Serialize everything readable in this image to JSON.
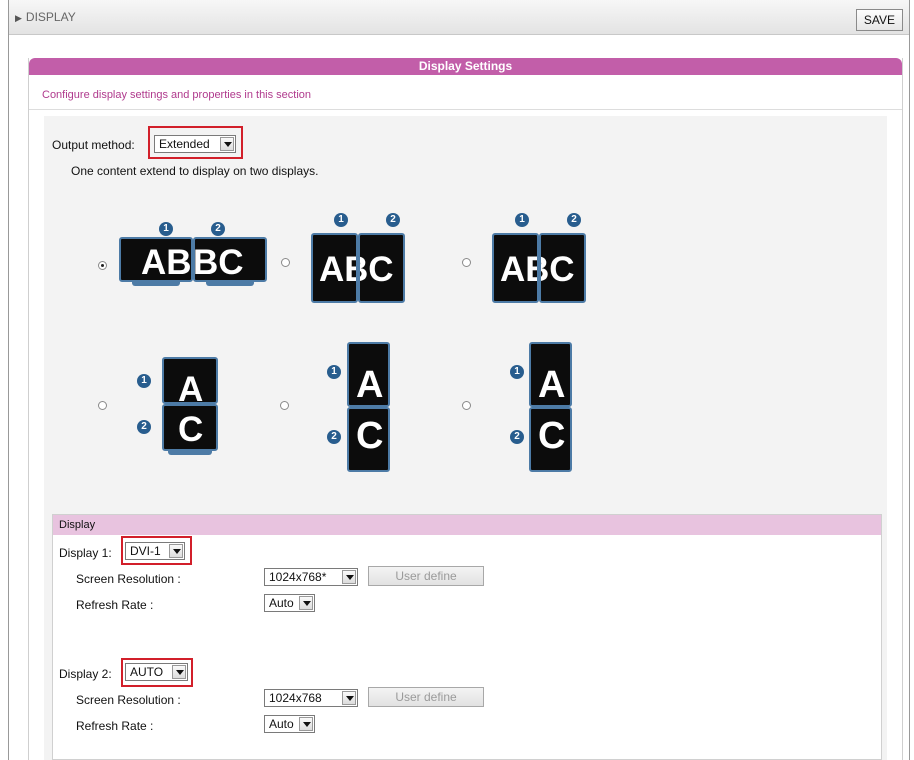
{
  "header": {
    "breadcrumb": "DISPLAY",
    "save_label": "SAVE"
  },
  "panel": {
    "title": "Display Settings",
    "description": "Configure display settings and properties in this section"
  },
  "output": {
    "label": "Output method:",
    "value": "Extended",
    "description": "One content extend to display on two displays."
  },
  "layouts": {
    "letters_a": "A",
    "letters_b": "B",
    "letters_c": "C",
    "letters_ab": "AB",
    "letters_bc": "BC",
    "badge1": "1",
    "badge2": "2",
    "selected_index": 0
  },
  "display_section": {
    "title": "Display",
    "display1": {
      "label": "Display 1:",
      "output": "DVI-1",
      "resolution_label": "Screen Resolution :",
      "resolution": "1024x768*",
      "user_define": "User define",
      "refresh_label": "Refresh Rate :",
      "refresh": "Auto"
    },
    "display2": {
      "label": "Display 2:",
      "output": "AUTO",
      "resolution_label": "Screen Resolution :",
      "resolution": "1024x768",
      "user_define": "User define",
      "refresh_label": "Refresh Rate :",
      "refresh": "Auto"
    }
  },
  "colors": {
    "accent": "#c25ea9",
    "highlight": "#d21f2a",
    "monitor_border": "#4d7ba6"
  }
}
